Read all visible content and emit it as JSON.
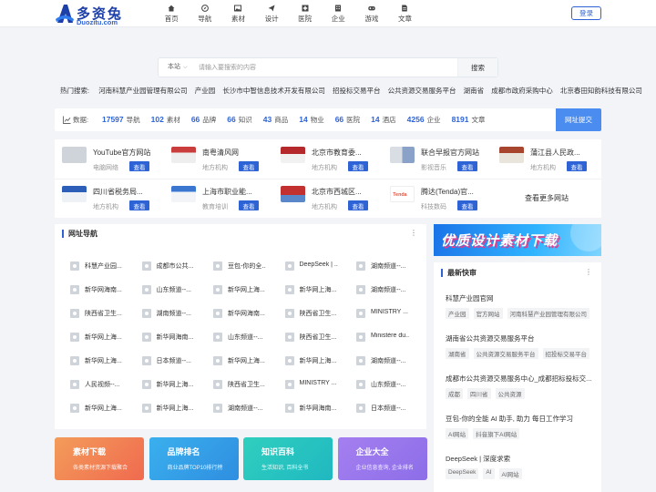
{
  "logo": {
    "text": "多资兔",
    "sub": "Duozitu.com"
  },
  "nav": [
    {
      "label": "首页",
      "icon": "home-icon"
    },
    {
      "label": "导航",
      "icon": "compass-icon"
    },
    {
      "label": "素材",
      "icon": "image-icon"
    },
    {
      "label": "设计",
      "icon": "paper-plane-icon"
    },
    {
      "label": "医院",
      "icon": "hospital-icon"
    },
    {
      "label": "企业",
      "icon": "building-icon"
    },
    {
      "label": "游戏",
      "icon": "gamepad-icon"
    },
    {
      "label": "文章",
      "icon": "document-icon"
    }
  ],
  "login_label": "登录",
  "search": {
    "scope": "本站",
    "placeholder": "请输入要搜索的内容",
    "button": "搜索"
  },
  "hotwords": {
    "label": "热门搜索:",
    "items": [
      "河南科慧产业园管理有限公司",
      "产业园",
      "长沙市中智信息技术开发有限公司",
      "招投标交易平台",
      "公共资源交易服务平台",
      "湖南省",
      "成都市政府采购中心",
      "北京春田知韵科技有限公司"
    ]
  },
  "stats": {
    "label": "数据:",
    "items": [
      {
        "num": "17597",
        "label": "导航"
      },
      {
        "num": "102",
        "label": "素材"
      },
      {
        "num": "66",
        "label": "品牌"
      },
      {
        "num": "66",
        "label": "知识"
      },
      {
        "num": "43",
        "label": "商品"
      },
      {
        "num": "14",
        "label": "物业"
      },
      {
        "num": "66",
        "label": "医院"
      },
      {
        "num": "14",
        "label": "酒店"
      },
      {
        "num": "4256",
        "label": "企业"
      },
      {
        "num": "8191",
        "label": "文章"
      }
    ],
    "submit": "网址提交"
  },
  "sites": [
    {
      "name": "YouTube官方网站",
      "cat": "电脑网络",
      "btn": "查看",
      "thumb": "#cfd3da"
    },
    {
      "name": "南粤清风网",
      "cat": "地方机构",
      "btn": "查看",
      "thumb": "#c93d3d"
    },
    {
      "name": "北京市教育委...",
      "cat": "地方机构",
      "btn": "查看",
      "thumb": "#b5282b"
    },
    {
      "name": "联合早报官方网站",
      "cat": "影视音乐",
      "btn": "查看",
      "thumb": "#d9dde4"
    },
    {
      "name": "蒲江县人民政...",
      "cat": "地方机构",
      "btn": "查看",
      "thumb": "#a7452f"
    },
    {
      "name": "四川省税务局...",
      "cat": "地方机构",
      "btn": "查看",
      "thumb": "#2d5fb8"
    },
    {
      "name": "上海市职业能...",
      "cat": "教育培训",
      "btn": "查看",
      "thumb": "#3b77d0"
    },
    {
      "name": "北京市西城区...",
      "cat": "地方机构",
      "btn": "查看",
      "thumb": "#c33030"
    },
    {
      "name": "腾达(Tenda)官...",
      "cat": "科技数码",
      "btn": "查看",
      "thumb": "#e8503a"
    }
  ],
  "sites_more": "查看更多网站",
  "navpanel": {
    "title": "网址导航",
    "more": "⋮",
    "links": [
      "科慧产业园...",
      "成都市公共...",
      "豆包-你的全...",
      "DeepSeek | ...",
      "湖南频道--...",
      "新华网海南...",
      "山东频道--...",
      "新华网上海...",
      "新华网上海...",
      "湖南频道--...",
      "陕西省卫生...",
      "湖南频道--...",
      "新华网海南...",
      "陕西省卫生...",
      "MINISTRY ...",
      "新华网上海...",
      "新华网海南...",
      "山东频道--...",
      "陕西省卫生...",
      "Ministère du...",
      "新华网上海...",
      "日本频道--...",
      "新华网上海...",
      "新华网上海...",
      "湖南频道--...",
      "人民视频--...",
      "新华网上海...",
      "陕西省卫生...",
      "MINISTRY ...",
      "山东频道--...",
      "新华网上海...",
      "新华网上海...",
      "湖南频道--...",
      "新华网海南...",
      "日本频道--..."
    ]
  },
  "promos": [
    {
      "title": "素材下载",
      "sub": "各类素材资源下载聚合",
      "color1": "#f39c5a",
      "color2": "#f06a4f"
    },
    {
      "title": "品牌排名",
      "sub": "商业品牌TOP10排行榜",
      "color1": "#3ab0ee",
      "color2": "#2f8ee0"
    },
    {
      "title": "知识百科",
      "sub": "生活知识, 百科全书",
      "color1": "#2fcfbf",
      "color2": "#20b8c0"
    },
    {
      "title": "企业大全",
      "sub": "企业信息查询, 企业排名",
      "color1": "#a47ff0",
      "color2": "#8d6ee8"
    }
  ],
  "banner": {
    "text": "优质设计素材下载"
  },
  "latest": {
    "title": "最新快审",
    "more": "⋮",
    "entries": [
      {
        "name": "科慧产业园官网",
        "tags": [
          "产业园",
          "官方网站",
          "河南科慧产业园管理有限公司"
        ]
      },
      {
        "name": "湖南省公共资源交易服务平台",
        "tags": [
          "湖南省",
          "公共资源交易服务平台",
          "招投标交易平台"
        ]
      },
      {
        "name": "成都市公共资源交易服务中心_成都招标投标交...",
        "tags": [
          "成都",
          "四川省",
          "公共资源"
        ]
      },
      {
        "name": "豆包-你的全能 AI 助手, 助力 每日工作学习",
        "tags": [
          "AI网站",
          "抖音旗下AI网站"
        ]
      },
      {
        "name": "DeepSeek | 深度求索",
        "tags": [
          "DeepSeek",
          "AI",
          "AI网站"
        ]
      }
    ]
  }
}
